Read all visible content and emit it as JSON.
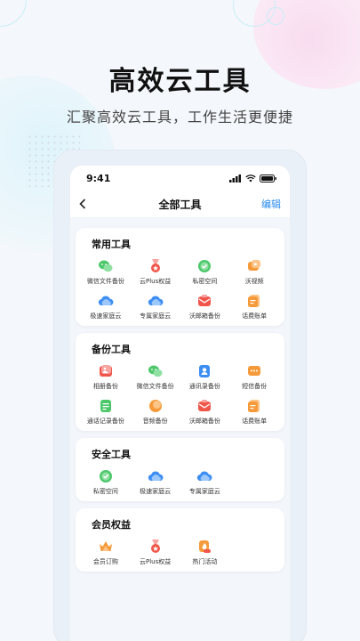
{
  "hero": {
    "title": "高效云工具",
    "subtitle": "汇聚高效云工具，工作生活更便捷"
  },
  "status_bar": {
    "time": "9:41"
  },
  "nav": {
    "title": "全部工具",
    "edit_label": "编辑"
  },
  "colors": {
    "accent": "#2a8cf0",
    "green": "#4cc76a",
    "red": "#f0564a",
    "orange": "#f59a3a",
    "blue": "#3d8ef2"
  },
  "sections": [
    {
      "title": "常用工具",
      "tools": [
        {
          "label": "微信文件备份",
          "icon": "wechat-icon"
        },
        {
          "label": "云Plus权益",
          "icon": "medal-icon"
        },
        {
          "label": "私密空间",
          "icon": "shield-check-icon"
        },
        {
          "label": "沃视频",
          "icon": "video-hand-icon"
        },
        {
          "label": "极速家庭云",
          "icon": "cloud-icon"
        },
        {
          "label": "专属家庭云",
          "icon": "cloud-icon"
        },
        {
          "label": "沃邮箱备份",
          "icon": "mailbox-icon"
        },
        {
          "label": "话费账单",
          "icon": "bill-icon"
        }
      ]
    },
    {
      "title": "备份工具",
      "tools": [
        {
          "label": "相册备份",
          "icon": "photo-icon"
        },
        {
          "label": "微信文件备份",
          "icon": "wechat-icon"
        },
        {
          "label": "通讯录备份",
          "icon": "contacts-icon"
        },
        {
          "label": "短信备份",
          "icon": "sms-icon"
        },
        {
          "label": "通话记录备份",
          "icon": "call-log-icon"
        },
        {
          "label": "音频备份",
          "icon": "audio-icon"
        },
        {
          "label": "沃邮箱备份",
          "icon": "mailbox-icon"
        },
        {
          "label": "话费账单",
          "icon": "bill-icon"
        }
      ]
    },
    {
      "title": "安全工具",
      "tools": [
        {
          "label": "私密空间",
          "icon": "shield-check-icon"
        },
        {
          "label": "极速家庭云",
          "icon": "cloud-icon"
        },
        {
          "label": "专属家庭云",
          "icon": "cloud-icon"
        }
      ]
    },
    {
      "title": "会员权益",
      "tools": [
        {
          "label": "会员订购",
          "icon": "crown-icon"
        },
        {
          "label": "云Plus权益",
          "icon": "medal-icon"
        },
        {
          "label": "热门活动",
          "icon": "hot-event-icon"
        }
      ]
    }
  ]
}
